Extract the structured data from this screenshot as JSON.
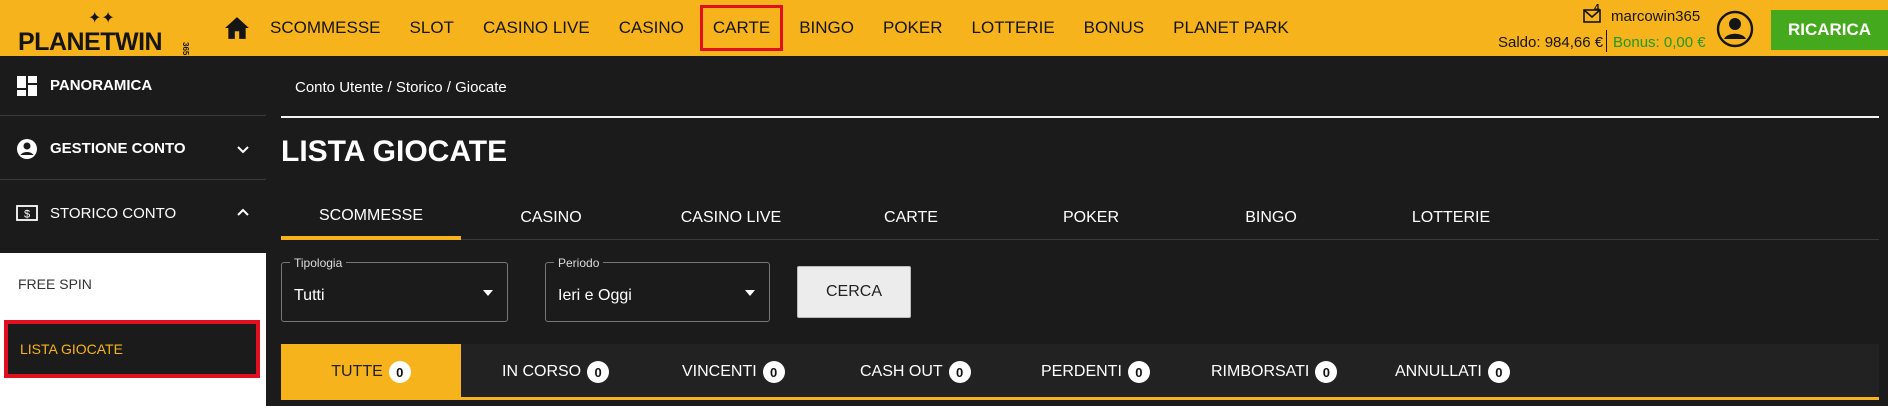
{
  "logo": {
    "text": "PLANETWIN",
    "sub": "365"
  },
  "nav": [
    "SCOMMESSE",
    "SLOT",
    "CASINO LIVE",
    "CASINO",
    "CARTE",
    "BINGO",
    "POKER",
    "LOTTERIE",
    "BONUS",
    "PLANET PARK"
  ],
  "nav_active": "CARTE",
  "user": {
    "name": "marcowin365",
    "mail_count": "4",
    "saldo": "Saldo: 984,66 €",
    "bonus": "Bonus: 0,00 €"
  },
  "ricarica": "RICARICA",
  "sidebar": {
    "panoramica": "PANORAMICA",
    "gestione": "GESTIONE CONTO",
    "storico": "STORICO CONTO",
    "sub": [
      "FREE SPIN",
      "LISTA GIOCATE"
    ]
  },
  "breadcrumb": "Conto Utente / Storico / Giocate",
  "title": "LISTA GIOCATE",
  "tabs": [
    "SCOMMESSE",
    "CASINO",
    "CASINO LIVE",
    "CARTE",
    "POKER",
    "BINGO",
    "LOTTERIE"
  ],
  "form": {
    "tipologia_label": "Tipologia",
    "tipologia_value": "Tutti",
    "periodo_label": "Periodo",
    "periodo_value": "Ieri e Oggi",
    "cerca": "CERCA"
  },
  "filters": [
    {
      "label": "TUTTE",
      "count": "0"
    },
    {
      "label": "IN CORSO",
      "count": "0"
    },
    {
      "label": "VINCENTI",
      "count": "0"
    },
    {
      "label": "CASH OUT",
      "count": "0"
    },
    {
      "label": "PERDENTI",
      "count": "0"
    },
    {
      "label": "RIMBORSATI",
      "count": "0"
    },
    {
      "label": "ANNULLATI",
      "count": "0"
    }
  ],
  "colors": {
    "accent": "#f7b31b",
    "green": "#44a91c",
    "highlight": "#e01020"
  }
}
